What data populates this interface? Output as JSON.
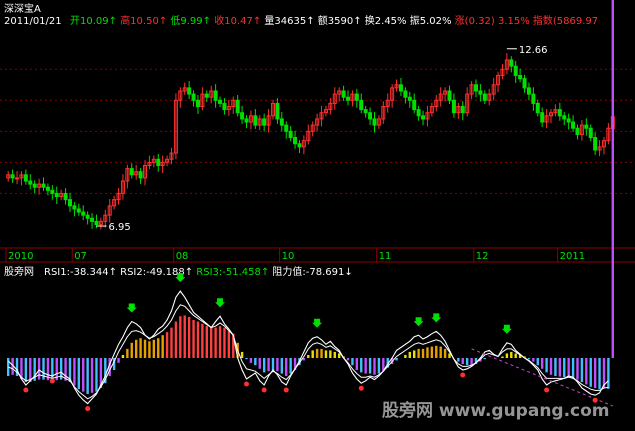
{
  "header": {
    "title": "深深宝A",
    "date": "2011/01/21",
    "quote": [
      {
        "label": "开",
        "value": "10.09",
        "arrow": "↑",
        "color": "#00e000"
      },
      {
        "label": "高",
        "value": "10.50",
        "arrow": "↑",
        "color": "#ff3030"
      },
      {
        "label": "低",
        "value": "9.99",
        "arrow": "↑",
        "color": "#00e000"
      },
      {
        "label": "收",
        "value": "10.47",
        "arrow": "↑",
        "color": "#ff3030"
      },
      {
        "label": "量",
        "value": "34635",
        "arrow": "↑",
        "color": "#ffffff"
      },
      {
        "label": "额",
        "value": "3590",
        "arrow": "↑",
        "color": "#ffffff"
      },
      {
        "label": "换",
        "value": "2.45%",
        "arrow": "",
        "color": "#ffffff"
      },
      {
        "label": "振",
        "value": "5.02%",
        "arrow": "",
        "color": "#ffffff"
      },
      {
        "label": "涨",
        "value": "(0.32)",
        "arrow": "",
        "color": "#ff3030"
      },
      {
        "label": "",
        "value": "3.15%",
        "arrow": "",
        "color": "#ff3030"
      },
      {
        "label": "指数",
        "value": "(5869.97",
        "arrow": "",
        "color": "#ff3030"
      }
    ]
  },
  "indicator": {
    "name": "股旁网",
    "items": [
      {
        "label": "RSI1:",
        "value": "-38.344",
        "arrow": "↑",
        "color": "#ffffff"
      },
      {
        "label": "RSI2:",
        "value": "-49.188",
        "arrow": "↑",
        "color": "#ffffff"
      },
      {
        "label": "RSI3:",
        "value": "-51.458",
        "arrow": "↑",
        "color": "#00e000"
      },
      {
        "label": "阻力值:",
        "value": "-78.691",
        "arrow": "↓",
        "color": "#ffffff"
      }
    ]
  },
  "watermark": "股旁网 www.gupang.com",
  "colors": {
    "up": "#ff3030",
    "down": "#00e000",
    "grid": "#8b0000",
    "axis_text": "#00e000",
    "rsi_bar_high": "#ff4040",
    "rsi_bar_mid": "#e8a000",
    "rsi_bar_low_cyan": "#40c0ff",
    "rsi_bar_low_magenta": "#c050ff"
  },
  "chart_data": [
    {
      "type": "candlestick",
      "title": "深深宝A",
      "ylim": [
        6.5,
        13.2
      ],
      "grid": true,
      "x_tick_labels": [
        "2010",
        "07",
        "08",
        "10",
        "11",
        "12",
        "2011"
      ],
      "annotations": [
        {
          "text": "12.66",
          "value": 12.66,
          "kind": "high"
        },
        {
          "text": "6.95",
          "value": 6.95,
          "kind": "low"
        }
      ],
      "series": [
        {
          "name": "close",
          "values": [
            8.6,
            8.5,
            8.5,
            8.6,
            8.4,
            8.3,
            8.2,
            8.3,
            8.2,
            8.1,
            8.0,
            7.9,
            8.0,
            7.8,
            7.6,
            7.5,
            7.4,
            7.3,
            7.2,
            7.1,
            7.0,
            7.1,
            7.3,
            7.6,
            7.8,
            8.0,
            8.4,
            8.8,
            8.6,
            8.7,
            8.5,
            8.9,
            9.0,
            9.1,
            8.9,
            9.0,
            9.1,
            9.3,
            11.0,
            11.3,
            11.4,
            11.2,
            11.0,
            10.8,
            11.2,
            11.1,
            11.3,
            11.0,
            10.9,
            10.7,
            10.8,
            11.0,
            10.6,
            10.4,
            10.3,
            10.5,
            10.2,
            10.4,
            10.2,
            10.5,
            10.9,
            10.4,
            10.2,
            10.0,
            9.8,
            9.6,
            9.5,
            9.7,
            10.0,
            10.2,
            10.4,
            10.6,
            10.7,
            10.9,
            11.2,
            11.3,
            11.1,
            11.0,
            11.2,
            11.0,
            10.7,
            10.6,
            10.4,
            10.2,
            10.4,
            10.8,
            11.0,
            11.4,
            11.5,
            11.3,
            11.1,
            11.0,
            10.7,
            10.5,
            10.4,
            10.6,
            10.8,
            11.0,
            11.2,
            11.3,
            11.0,
            10.6,
            10.8,
            10.6,
            11.2,
            11.5,
            11.3,
            11.2,
            11.0,
            11.2,
            11.5,
            11.8,
            12.0,
            12.3,
            12.1,
            11.8,
            11.7,
            11.4,
            11.2,
            10.9,
            10.6,
            10.3,
            10.5,
            10.6,
            10.7,
            10.5,
            10.4,
            10.3,
            10.1,
            9.9,
            10.2,
            10.1,
            9.8,
            9.4,
            9.5,
            9.7,
            10.1,
            10.47
          ]
        },
        {
          "name": "open",
          "values": [
            8.5,
            8.6,
            8.5,
            8.5,
            8.6,
            8.4,
            8.3,
            8.2,
            8.3,
            8.2,
            8.1,
            8.0,
            7.9,
            8.0,
            7.8,
            7.6,
            7.5,
            7.4,
            7.3,
            7.2,
            7.1,
            7.0,
            7.1,
            7.3,
            7.6,
            7.8,
            8.0,
            8.4,
            8.8,
            8.6,
            8.7,
            8.5,
            8.9,
            9.0,
            9.1,
            8.9,
            9.0,
            9.1,
            9.3,
            11.0,
            11.3,
            11.4,
            11.2,
            11.0,
            10.8,
            11.2,
            11.1,
            11.3,
            11.0,
            10.9,
            10.7,
            10.8,
            11.0,
            10.6,
            10.4,
            10.3,
            10.5,
            10.2,
            10.4,
            10.2,
            10.5,
            10.9,
            10.4,
            10.2,
            10.0,
            9.8,
            9.6,
            9.5,
            9.7,
            10.0,
            10.2,
            10.4,
            10.6,
            10.7,
            10.9,
            11.2,
            11.3,
            11.1,
            11.0,
            11.2,
            11.0,
            10.7,
            10.6,
            10.4,
            10.2,
            10.4,
            10.8,
            11.0,
            11.4,
            11.5,
            11.3,
            11.1,
            11.0,
            10.7,
            10.5,
            10.4,
            10.6,
            10.8,
            11.0,
            11.2,
            11.3,
            11.0,
            10.6,
            10.8,
            10.6,
            11.2,
            11.5,
            11.3,
            11.2,
            11.0,
            11.2,
            11.5,
            11.8,
            12.0,
            12.3,
            12.1,
            11.8,
            11.7,
            11.4,
            11.2,
            10.9,
            10.6,
            10.3,
            10.5,
            10.6,
            10.7,
            10.5,
            10.4,
            10.3,
            10.1,
            9.9,
            10.2,
            10.1,
            9.8,
            9.4,
            9.5,
            9.7,
            10.09
          ]
        }
      ]
    },
    {
      "type": "line",
      "title": "股旁网",
      "ylim": [
        -100,
        100
      ],
      "series": [
        {
          "name": "RSI1",
          "values": [
            -5,
            -12,
            -20,
            -35,
            -45,
            -38,
            -30,
            -20,
            -25,
            -28,
            -30,
            -26,
            -24,
            -30,
            -35,
            -50,
            -62,
            -70,
            -76,
            -68,
            -60,
            -45,
            -30,
            -10,
            5,
            18,
            28,
            40,
            48,
            45,
            40,
            30,
            25,
            30,
            38,
            42,
            50,
            62,
            80,
            88,
            80,
            70,
            60,
            55,
            50,
            45,
            40,
            48,
            55,
            45,
            38,
            30,
            0,
            -20,
            -35,
            -30,
            -25,
            -38,
            -45,
            -30,
            -20,
            -28,
            -40,
            -45,
            -30,
            -18,
            -5,
            8,
            20,
            26,
            28,
            24,
            18,
            22,
            15,
            10,
            0,
            -10,
            -25,
            -35,
            -42,
            -38,
            -32,
            -36,
            -30,
            -22,
            -10,
            0,
            10,
            14,
            18,
            22,
            28,
            30,
            25,
            28,
            32,
            35,
            30,
            22,
            10,
            -2,
            -15,
            -20,
            -18,
            -14,
            -8,
            0,
            8,
            10,
            5,
            2,
            12,
            20,
            18,
            10,
            5,
            0,
            -5,
            -12,
            -20,
            -35,
            -45,
            -40,
            -38,
            -36,
            -34,
            -30,
            -32,
            -40,
            -50,
            -55,
            -60,
            -62,
            -58,
            -45,
            -38
          ]
        },
        {
          "name": "RSI2",
          "values": [
            -15,
            -18,
            -24,
            -32,
            -38,
            -36,
            -32,
            -28,
            -30,
            -32,
            -34,
            -32,
            -30,
            -34,
            -38,
            -48,
            -56,
            -62,
            -68,
            -64,
            -58,
            -48,
            -36,
            -20,
            -6,
            8,
            18,
            28,
            35,
            36,
            34,
            30,
            26,
            28,
            32,
            36,
            42,
            50,
            62,
            70,
            68,
            62,
            56,
            52,
            48,
            44,
            40,
            42,
            46,
            42,
            36,
            30,
            10,
            -6,
            -18,
            -20,
            -22,
            -28,
            -34,
            -28,
            -22,
            -26,
            -32,
            -36,
            -28,
            -18,
            -8,
            2,
            12,
            18,
            20,
            18,
            14,
            16,
            12,
            8,
            0,
            -8,
            -18,
            -26,
            -32,
            -32,
            -30,
            -32,
            -28,
            -22,
            -14,
            -6,
            2,
            6,
            10,
            14,
            18,
            20,
            18,
            20,
            22,
            24,
            22,
            16,
            8,
            -2,
            -10,
            -14,
            -14,
            -12,
            -8,
            -2,
            4,
            6,
            4,
            2,
            8,
            12,
            12,
            8,
            4,
            0,
            -4,
            -10,
            -16,
            -26,
            -34,
            -34,
            -34,
            -34,
            -34,
            -32,
            -34,
            -38,
            -44,
            -48,
            -52,
            -54,
            -54,
            -50,
            -49
          ]
        }
      ],
      "bars": {
        "name": "RSI3",
        "values": [
          -30,
          -28,
          -30,
          -35,
          -40,
          -40,
          -38,
          -36,
          -36,
          -37,
          -38,
          -37,
          -36,
          -38,
          -40,
          -46,
          -52,
          -56,
          -60,
          -58,
          -56,
          -50,
          -42,
          -30,
          -20,
          -8,
          4,
          12,
          20,
          24,
          26,
          24,
          22,
          24,
          26,
          30,
          34,
          40,
          48,
          55,
          56,
          54,
          50,
          48,
          45,
          42,
          40,
          40,
          42,
          40,
          36,
          32,
          20,
          8,
          -2,
          -8,
          -12,
          -18,
          -24,
          -22,
          -20,
          -22,
          -26,
          -30,
          -26,
          -20,
          -12,
          -4,
          4,
          10,
          12,
          12,
          10,
          10,
          8,
          6,
          2,
          -4,
          -12,
          -20,
          -24,
          -26,
          -26,
          -28,
          -26,
          -22,
          -16,
          -10,
          -4,
          0,
          4,
          8,
          10,
          12,
          12,
          14,
          15,
          16,
          15,
          12,
          6,
          0,
          -6,
          -10,
          -12,
          -12,
          -10,
          -6,
          -2,
          0,
          0,
          0,
          2,
          6,
          8,
          6,
          4,
          2,
          -2,
          -6,
          -12,
          -18,
          -24,
          -28,
          -30,
          -31,
          -32,
          -32,
          -33,
          -36,
          -40,
          -44,
          -48,
          -50,
          -52,
          -50,
          -51.458
        ]
      },
      "resistance": {
        "name": "阻力值",
        "value": -78.691
      }
    }
  ]
}
